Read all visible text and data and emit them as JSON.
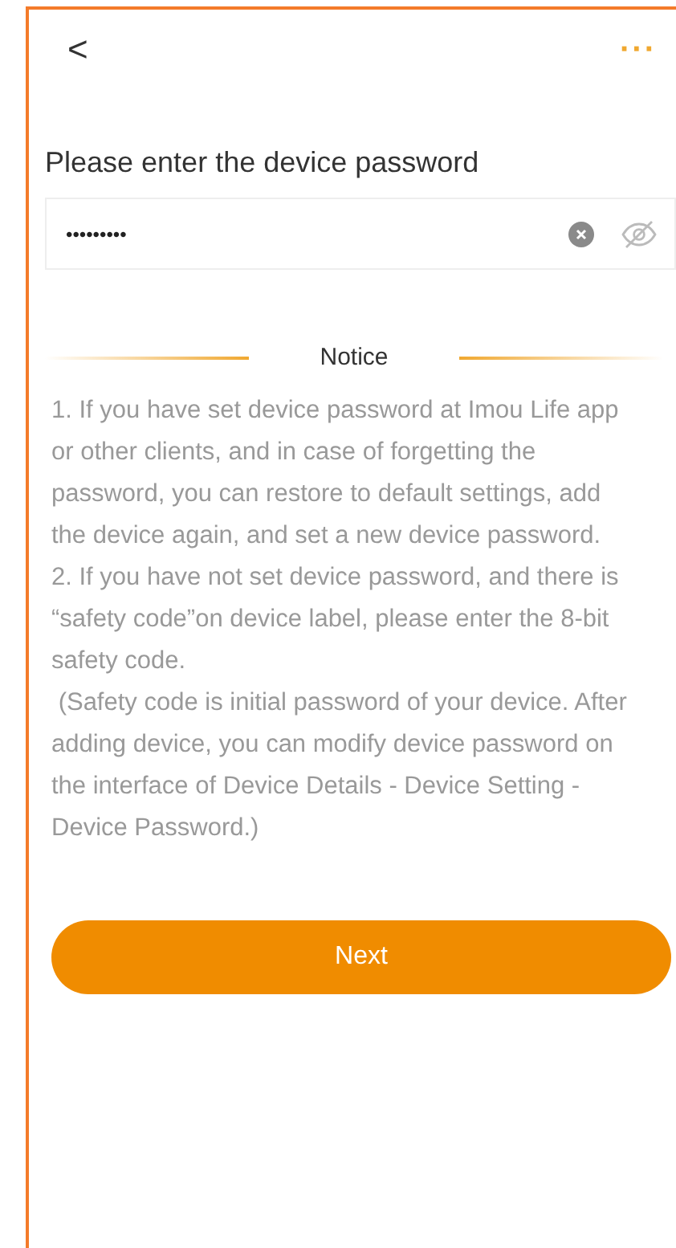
{
  "header": {
    "back": "<",
    "more": "···"
  },
  "title": "Please enter the device password",
  "password_field": {
    "value": "•••••••••",
    "masked": true
  },
  "notice": {
    "heading": "Notice",
    "paragraphs": [
      "1. If you have set device password at Imou Life app or other clients, and in case of forgetting the password, you can restore to default settings, add the device again, and set a new device password.",
      "2. If you have not set device password, and there is “safety code”on device label, please enter the 8-bit safety code.",
      " (Safety code is initial password of your device. After adding device, you can modify device password on the interface of Device Details - Device Setting - Device Password.)"
    ]
  },
  "next_button": "Next"
}
